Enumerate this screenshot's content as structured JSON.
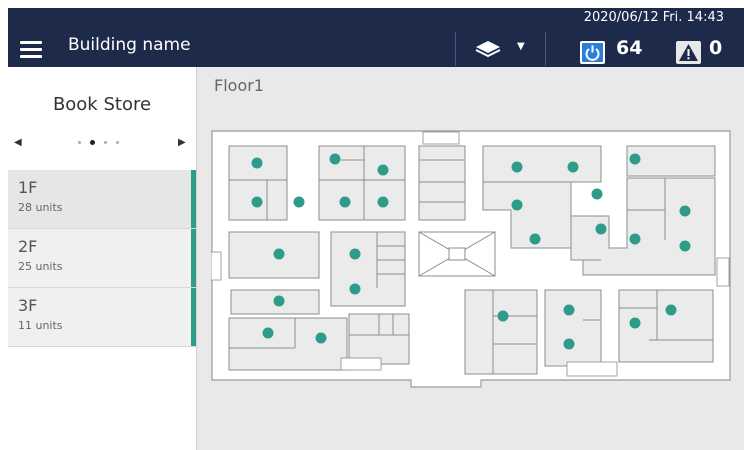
{
  "header": {
    "datetime": "2020/06/12 Fri. 14:43",
    "building_name": "Building name",
    "power_count": "64",
    "warning_count": "0",
    "colors": {
      "background": "#1e2a4a",
      "power_accent": "#2d7ed6"
    }
  },
  "sidebar": {
    "store_name": "Book Store",
    "carousel_page_count": 4,
    "carousel_active_index": 1,
    "floors": [
      {
        "name": "1F",
        "units": "28 units",
        "selected": true
      },
      {
        "name": "2F",
        "units": "25 units",
        "selected": false
      },
      {
        "name": "3F",
        "units": "11 units",
        "selected": false
      }
    ],
    "accent_color": "#2f9b8a"
  },
  "main": {
    "floor_title": "Floor1",
    "unit_color": "#2f9b8a"
  }
}
